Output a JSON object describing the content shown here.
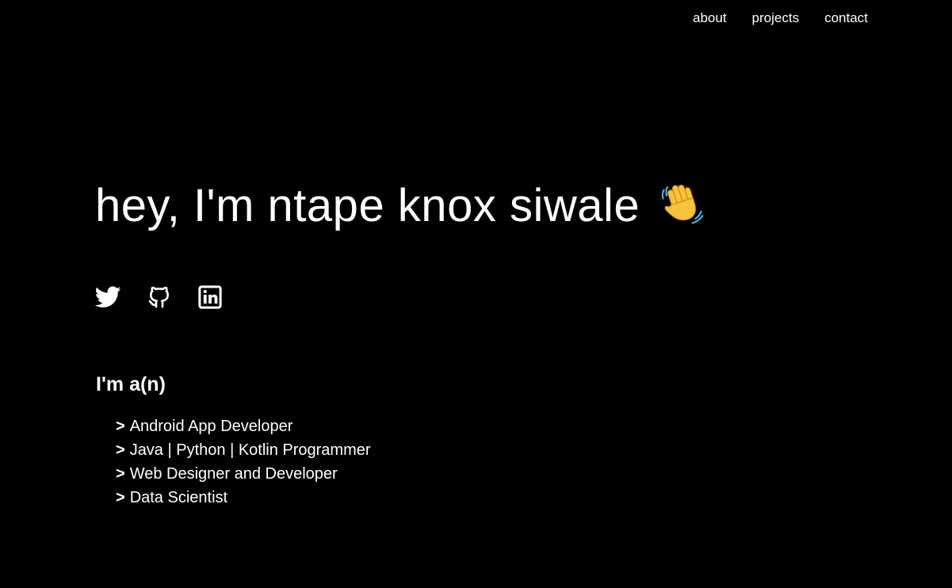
{
  "nav": {
    "items": [
      {
        "label": "about"
      },
      {
        "label": "projects"
      },
      {
        "label": "contact"
      }
    ]
  },
  "hero": {
    "title": "hey, I'm ntape knox siwale"
  },
  "socials": [
    {
      "icon": "twitter-icon"
    },
    {
      "icon": "github-icon"
    },
    {
      "icon": "linkedin-icon"
    }
  ],
  "roles": {
    "heading": "I'm a(n)",
    "prefix": ">",
    "items": [
      "Android App Developer",
      "Java | Python | Kotlin Programmer",
      "Web Designer and Developer",
      "Data Scientist"
    ]
  },
  "colors": {
    "background": "#000000",
    "text": "#ffffff",
    "emoji": "#f7c33b"
  }
}
